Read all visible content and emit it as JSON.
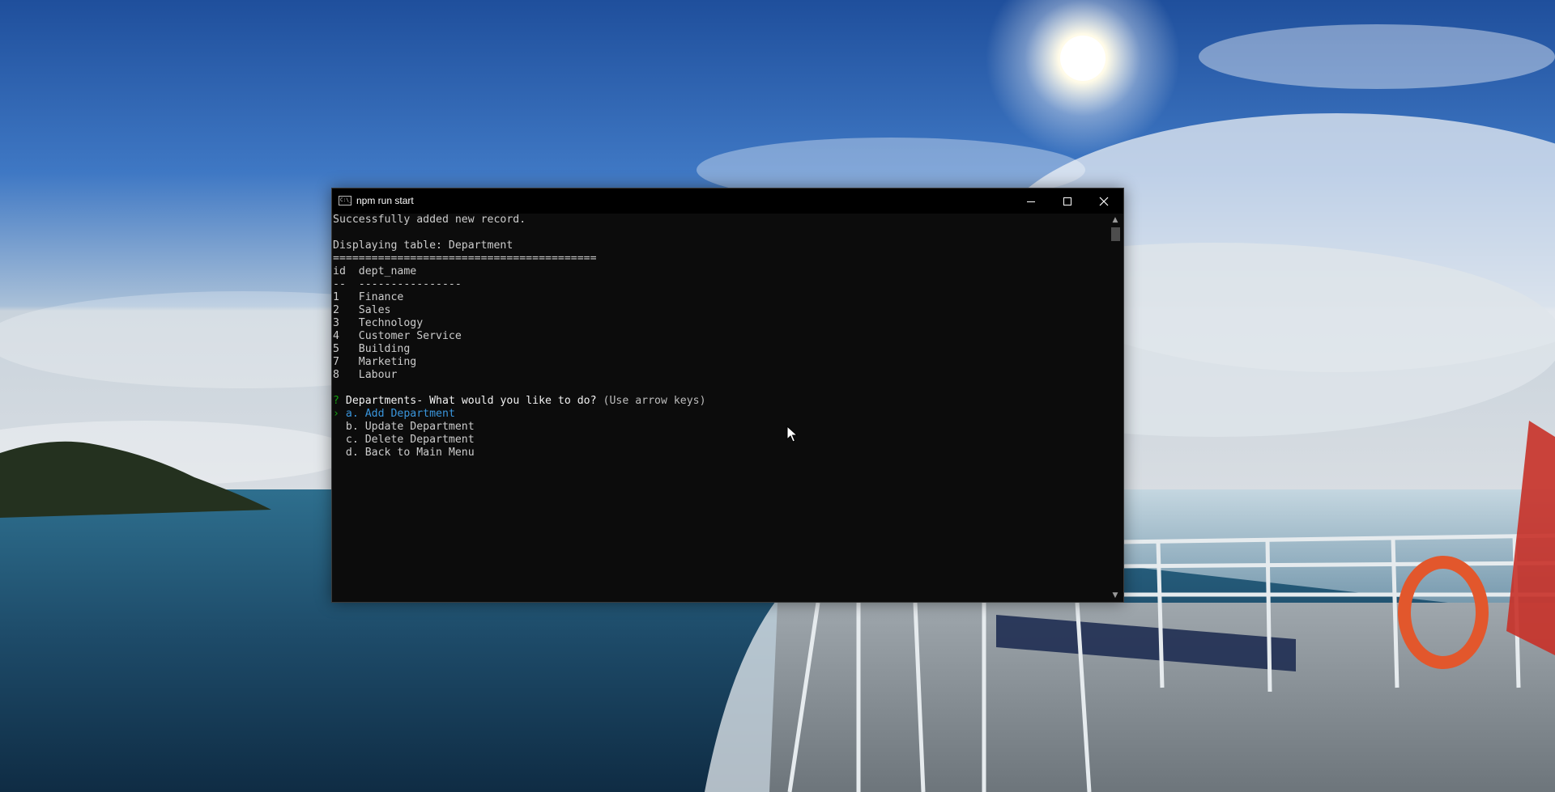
{
  "window": {
    "title": "npm run start",
    "icon": "cmd-icon",
    "icon_glyph": "C:\\_"
  },
  "controls": {
    "minimize": "minimize-icon",
    "maximize": "maximize-icon",
    "close": "close-icon"
  },
  "terminal": {
    "success_msg": "Successfully added new record.",
    "table_title": "Displaying table: Department",
    "separator": "=========================================",
    "header": "id  dept_name",
    "header_rule": "--  ----------------",
    "rows": [
      "1   Finance",
      "2   Sales",
      "3   Technology",
      "4   Customer Service",
      "5   Building",
      "7   Marketing",
      "8   Labour"
    ],
    "prompt_mark": "?",
    "prompt_text": "Departments- What would you like to do?",
    "prompt_hint": "(Use arrow keys)",
    "selector": "›",
    "options": [
      "a. Add Department",
      "b. Update Department",
      "c. Delete Department",
      "d. Back to Main Menu"
    ]
  },
  "colors": {
    "terminal_bg": "#0c0c0c",
    "terminal_fg": "#cccccc",
    "prompt_green": "#13a10e",
    "selected_blue": "#3a96dd"
  }
}
